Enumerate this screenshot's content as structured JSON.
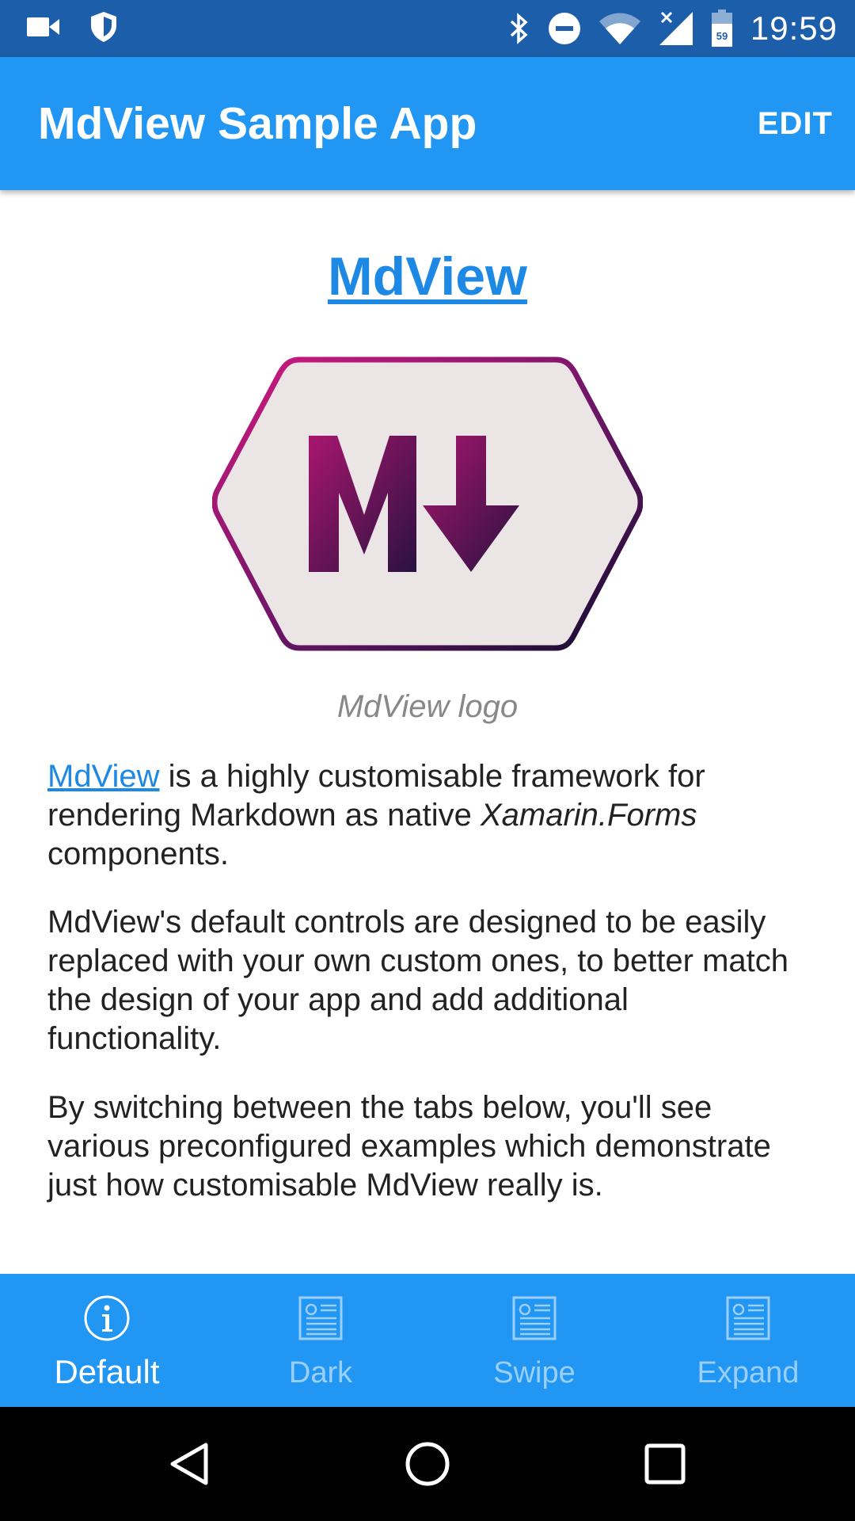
{
  "status_bar": {
    "time": "19:59",
    "left_icons": [
      "video-camera-icon",
      "shield-icon"
    ],
    "right_icons": [
      "bluetooth-icon",
      "do-not-disturb-icon",
      "wifi-icon",
      "signal-icon",
      "battery-icon"
    ],
    "battery_level_text": "59"
  },
  "app_bar": {
    "title": "MdView Sample App",
    "edit_label": "EDIT"
  },
  "content": {
    "heading": "MdView",
    "logo_alt": "MdView logo",
    "caption": "MdView logo",
    "p1": {
      "link": "MdView",
      "text1": " is a highly customisable framework for rendering Markdown as native ",
      "italic": "Xamarin.Forms",
      "text2": " components."
    },
    "p2": "MdView's default controls are designed to be easily replaced with your own custom ones, to better match the design of your app and add additional functionality.",
    "p3": "By switching between the tabs below, you'll see various preconfigured examples which demonstrate just how customisable MdView really is."
  },
  "tabs": [
    {
      "label": "Default",
      "icon": "info-icon",
      "active": true
    },
    {
      "label": "Dark",
      "icon": "document-icon",
      "active": false
    },
    {
      "label": "Swipe",
      "icon": "document-icon",
      "active": false
    },
    {
      "label": "Expand",
      "icon": "document-icon",
      "active": false
    }
  ],
  "nav_bar": {
    "buttons": [
      "back-icon",
      "home-icon",
      "recents-icon"
    ]
  },
  "colors": {
    "status_bar": "#1c5ea9",
    "primary": "#2196f3",
    "link": "#1e88e5",
    "logo_gradient_start": "#c2187a",
    "logo_gradient_end": "#1a1035"
  }
}
